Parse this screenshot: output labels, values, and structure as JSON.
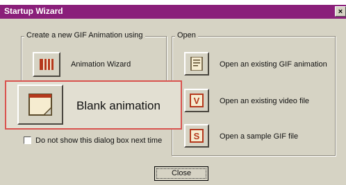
{
  "window": {
    "title": "Startup Wizard",
    "close_glyph": "×"
  },
  "create_group": {
    "legend": "Create a new GIF Animation using",
    "animation_wizard_label": "Animation Wizard",
    "blank_animation_label": "Blank animation"
  },
  "open_group": {
    "legend": "Open",
    "open_gif_label": "Open an existing GIF animation",
    "open_video_label": "Open an existing video file",
    "open_sample_label": "Open a sample GIF file"
  },
  "checkbox": {
    "label": "Do not show this dialog box next time",
    "checked": false
  },
  "footer": {
    "close_label": "Close"
  },
  "colors": {
    "titlebar": "#8a1f7a",
    "dialog_bg": "#d6d3c4",
    "icon_accent": "#b5381c",
    "highlight_border": "#d9534f"
  },
  "icons": {
    "animation_wizard": "wizard-bars-icon",
    "blank_animation": "blank-page-icon",
    "open_gif": "document-icon",
    "open_video": "letter-v-icon",
    "open_sample": "letter-s-icon"
  }
}
